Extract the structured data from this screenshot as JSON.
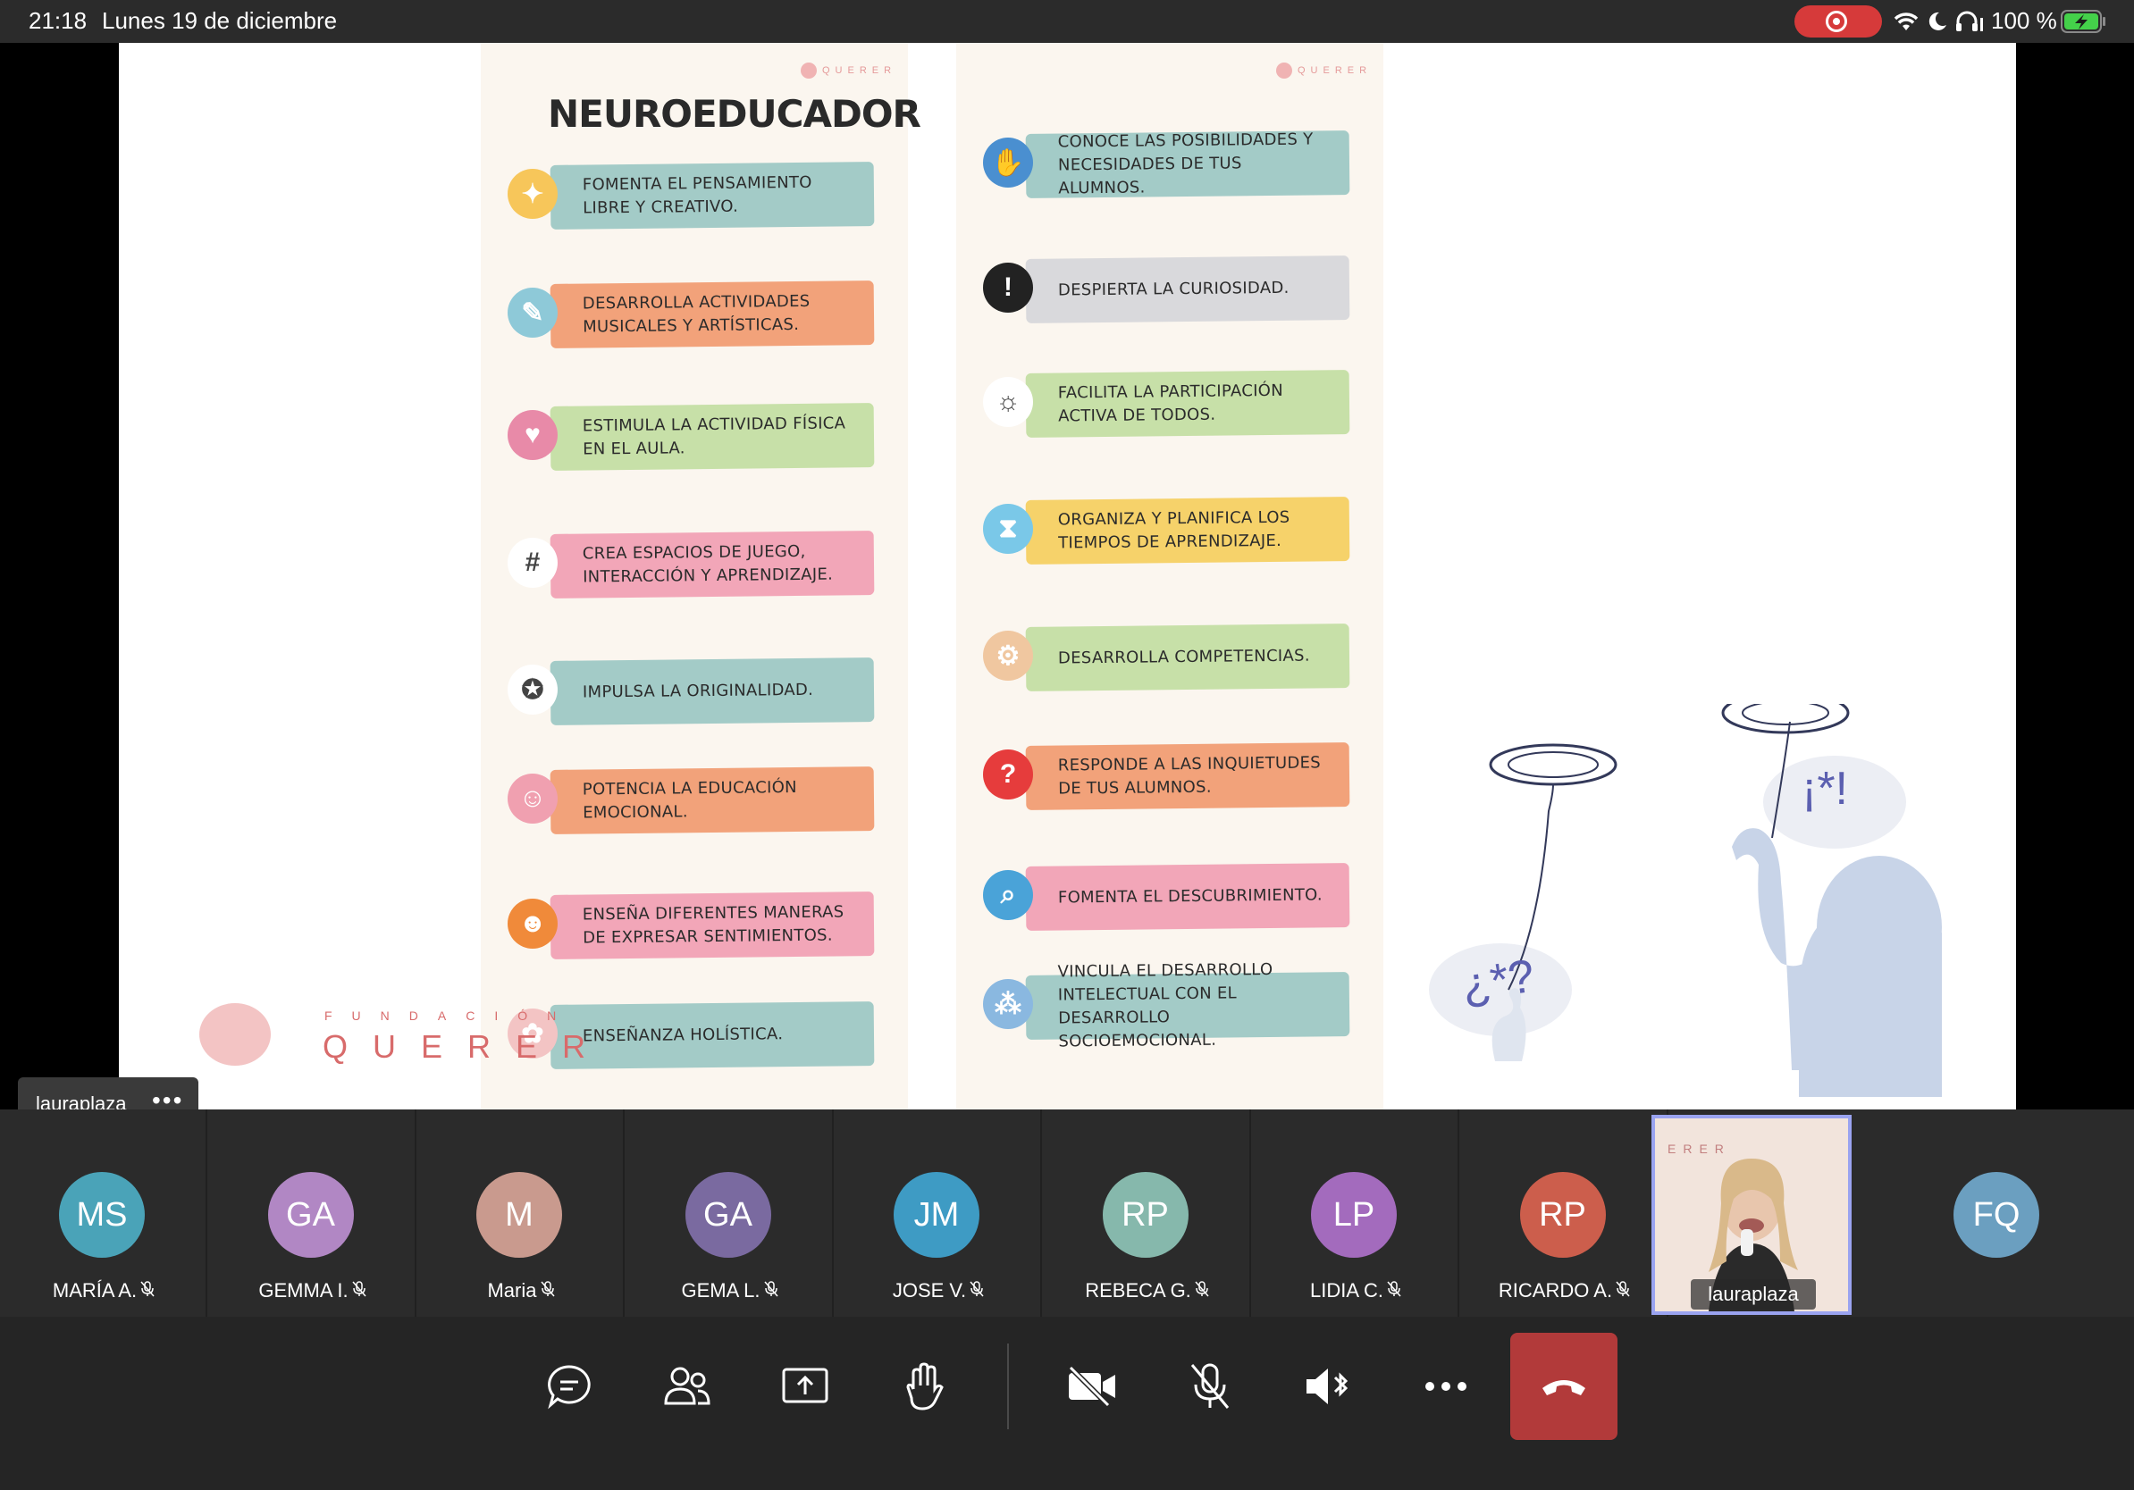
{
  "status_bar": {
    "time": "21:18",
    "date": "Lunes 19 de diciembre",
    "battery": "100 %"
  },
  "slide": {
    "brand_small": "QUERER",
    "title": "NEUROEDUCADOR",
    "left_items": [
      {
        "text": "FOMENTA EL PENSAMIENTO LIBRE Y CREATIVO.",
        "color": "#a3cbc7"
      },
      {
        "text": "DESARROLLA ACTIVIDADES MUSICALES Y ARTÍSTICAS.",
        "color": "#f2a27a"
      },
      {
        "text": "ESTIMULA LA ACTIVIDAD FÍSICA EN EL AULA.",
        "color": "#c7e0a8"
      },
      {
        "text": "CREA ESPACIOS DE JUEGO, INTERACCIÓN Y APRENDIZAJE.",
        "color": "#f2a6b8"
      },
      {
        "text": "IMPULSA LA ORIGINALIDAD.",
        "color": "#a3cbc7"
      },
      {
        "text": "POTENCIA LA EDUCACIÓN EMOCIONAL.",
        "color": "#f2a27a"
      },
      {
        "text": "ENSEÑA DIFERENTES MANERAS DE EXPRESAR SENTIMIENTOS.",
        "color": "#f2a6b8"
      },
      {
        "text": "ENSEÑANZA HOLÍSTICA.",
        "color": "#a3cbc7"
      }
    ],
    "right_items": [
      {
        "text": "CONOCE LAS POSIBILIDADES Y NECESIDADES DE TUS ALUMNOS.",
        "color": "#a3cbc7"
      },
      {
        "text": "DESPIERTA LA CURIOSIDAD.",
        "color": "#d9d9dc"
      },
      {
        "text": "FACILITA LA PARTICIPACIÓN ACTIVA DE TODOS.",
        "color": "#c7e0a8"
      },
      {
        "text": "ORGANIZA Y PLANIFICA LOS TIEMPOS DE APRENDIZAJE.",
        "color": "#f6d26a"
      },
      {
        "text": "DESARROLLA COMPETENCIAS.",
        "color": "#c7e0a8"
      },
      {
        "text": "RESPONDE A LAS INQUIETUDES DE TUS ALUMNOS.",
        "color": "#f2a27a"
      },
      {
        "text": "FOMENTA EL DESCUBRIMIENTO.",
        "color": "#f2a6b8"
      },
      {
        "text": "VINCULA EL DESARROLLO INTELECTUAL CON EL DESARROLLO SOCIOEMOCIONAL.",
        "color": "#a3cbc7"
      }
    ],
    "logo_small": "FUNDACIÓN",
    "logo_word": "QUERER",
    "bubble_left": "¿*?",
    "bubble_right": "¡*!"
  },
  "presenter_label": {
    "name": "lauraplaza",
    "more": "•••"
  },
  "participants": [
    {
      "initials": "MS",
      "name": "MARÍA A.",
      "color": "#4aa3b8"
    },
    {
      "initials": "GA",
      "name": "GEMMA I.",
      "color": "#b187c4"
    },
    {
      "initials": "M",
      "name": "Maria",
      "color": "#c99a8e"
    },
    {
      "initials": "GA",
      "name": "GEMA L.",
      "color": "#7a6aa0"
    },
    {
      "initials": "JM",
      "name": "JOSE V.",
      "color": "#3e9bc4"
    },
    {
      "initials": "RP",
      "name": "REBECA G.",
      "color": "#86b8ac"
    },
    {
      "initials": "LP",
      "name": "LIDIA C.",
      "color": "#a36bbd"
    },
    {
      "initials": "RP",
      "name": "RICARDO A.",
      "color": "#cc5e4c"
    }
  ],
  "video_participant": {
    "name": "lauraplaza",
    "bg_text": "ERER"
  },
  "last_participant": {
    "initials": "FQ",
    "color": "#6b9fc0"
  }
}
